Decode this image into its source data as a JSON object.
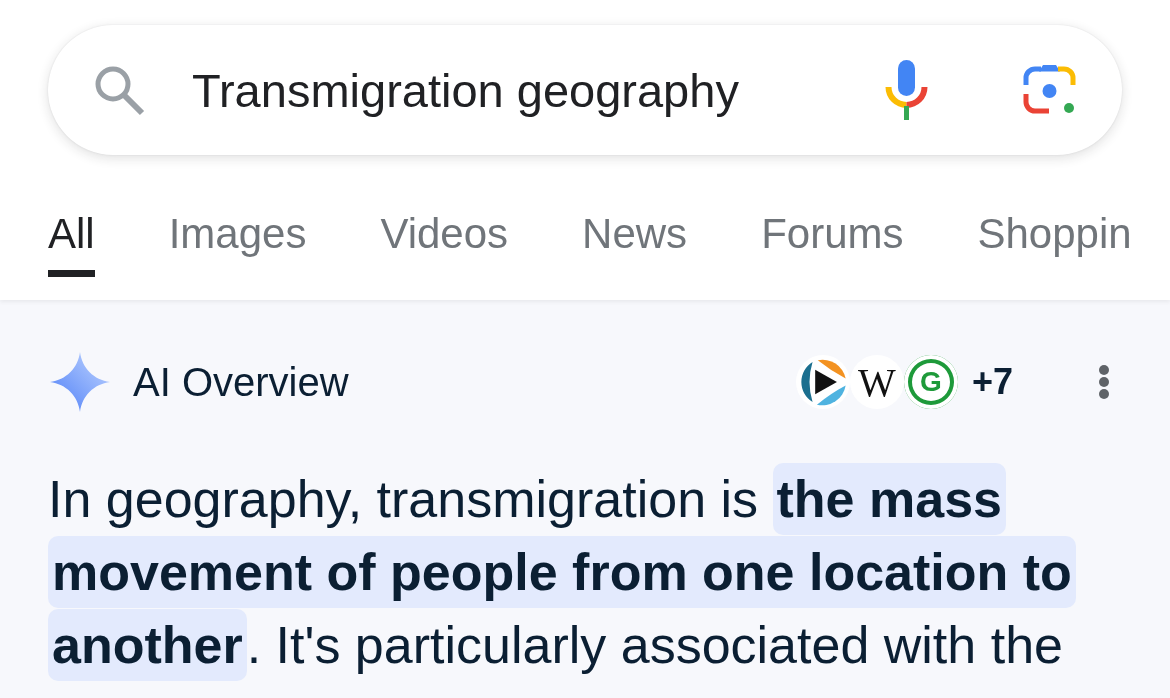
{
  "search": {
    "value": "Transmigration geography"
  },
  "tabs": [
    {
      "label": "All",
      "selected": true
    },
    {
      "label": "Images",
      "selected": false
    },
    {
      "label": "Videos",
      "selected": false
    },
    {
      "label": "News",
      "selected": false
    },
    {
      "label": "Forums",
      "selected": false
    },
    {
      "label": "Shoppin",
      "selected": false
    }
  ],
  "ai_overview": {
    "title": "AI Overview",
    "sources": [
      {
        "kind": "play"
      },
      {
        "kind": "serif-letter",
        "letter": "W"
      },
      {
        "kind": "ring-letter",
        "letter": "G"
      }
    ],
    "more_sources": "+7",
    "text": "In geography, transmigration is **the mass movement of people from one location to another**. It's particularly associated with the"
  }
}
